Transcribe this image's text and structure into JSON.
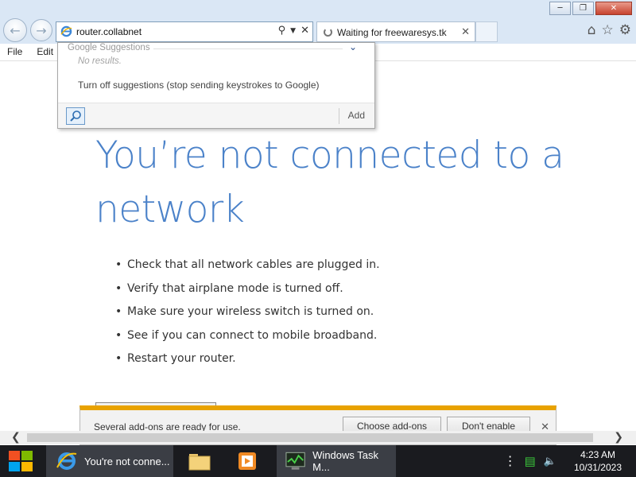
{
  "window": {
    "minimize_icon": "minimize-icon",
    "restore_icon": "restore-icon",
    "close_icon": "close-icon"
  },
  "address_bar": {
    "value": "router.collabnet"
  },
  "tab": {
    "title": "Waiting for freewaresys.tk"
  },
  "menu": {
    "file": "File",
    "edit": "Edit"
  },
  "suggestions": {
    "header": "Google Suggestions",
    "no_results": "No results.",
    "turn_off": "Turn off suggestions (stop sending keystrokes to Google)",
    "add": "Add"
  },
  "page": {
    "headline": "You’re not connected to a network",
    "bullets": [
      "Check that all network cables are plugged in.",
      "Verify that airplane mode is turned off.",
      "Make sure your wireless switch is turned on.",
      "See if you can connect to mobile broadband.",
      "Restart your router."
    ]
  },
  "notification": {
    "message": "Several add-ons are ready for use.",
    "choose": "Choose add-ons",
    "dont_enable": "Don't enable"
  },
  "taskbar": {
    "ie_task": "You're not conne...",
    "taskmgr_task": "Windows Task M...",
    "time": "4:23 AM",
    "date": "10/31/2023"
  },
  "colors": {
    "headline": "#4b82c9",
    "notification_accent": "#e8a200",
    "taskbar": "#1a1b1f"
  }
}
